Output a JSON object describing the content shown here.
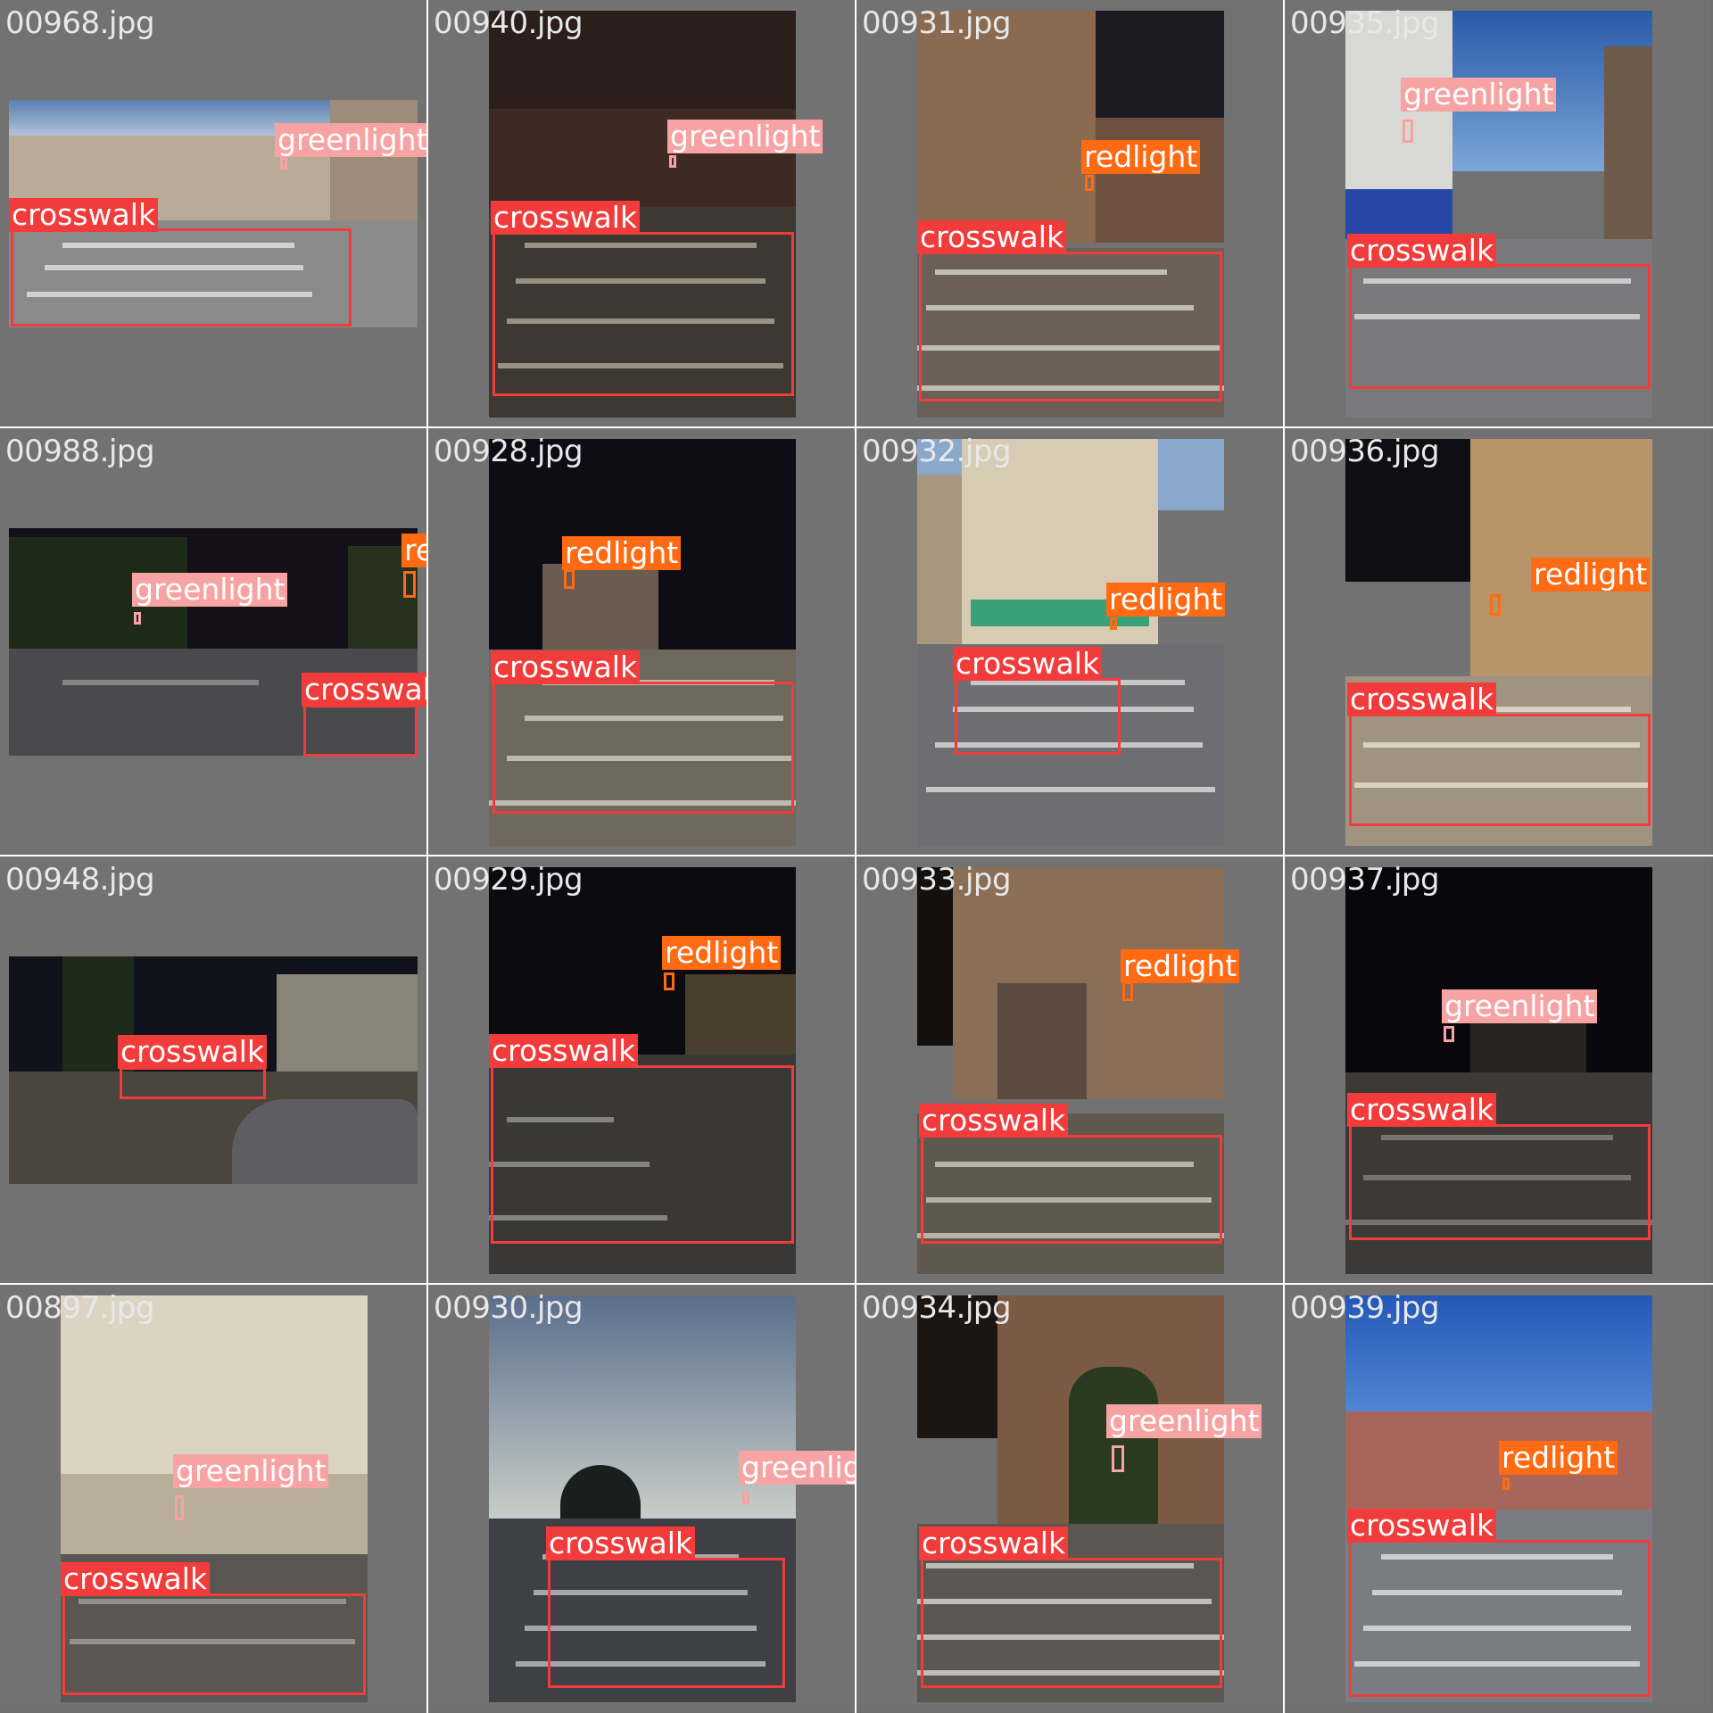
{
  "tiles": [
    {
      "filename": "00968.jpg",
      "labels": [
        "greenlight",
        "crosswalk"
      ]
    },
    {
      "filename": "00940.jpg",
      "labels": [
        "greenlight",
        "crosswalk"
      ]
    },
    {
      "filename": "00931.jpg",
      "labels": [
        "redlight",
        "crosswalk"
      ]
    },
    {
      "filename": "00935.jpg",
      "labels": [
        "greenlight",
        "crosswalk"
      ]
    },
    {
      "filename": "00988.jpg",
      "labels": [
        "redlight",
        "greenlight",
        "crosswalk"
      ]
    },
    {
      "filename": "00928.jpg",
      "labels": [
        "redlight",
        "crosswalk"
      ]
    },
    {
      "filename": "00932.jpg",
      "labels": [
        "redlight",
        "crosswalk"
      ]
    },
    {
      "filename": "00936.jpg",
      "labels": [
        "redlight",
        "crosswalk"
      ]
    },
    {
      "filename": "00948.jpg",
      "labels": [
        "crosswalk"
      ]
    },
    {
      "filename": "00929.jpg",
      "labels": [
        "redlight",
        "crosswalk"
      ]
    },
    {
      "filename": "00933.jpg",
      "labels": [
        "redlight",
        "crosswalk"
      ]
    },
    {
      "filename": "00937.jpg",
      "labels": [
        "greenlight",
        "crosswalk"
      ]
    },
    {
      "filename": "00897.jpg",
      "labels": [
        "greenlight",
        "crosswalk"
      ]
    },
    {
      "filename": "00930.jpg",
      "labels": [
        "greenlight",
        "crosswalk"
      ]
    },
    {
      "filename": "00934.jpg",
      "labels": [
        "greenlight",
        "crosswalk"
      ]
    },
    {
      "filename": "00939.jpg",
      "labels": [
        "redlight",
        "crosswalk"
      ]
    }
  ],
  "colors": {
    "crosswalk": "#f23b3b",
    "redlight": "#ff6a13",
    "greenlight": "#f7a3a3",
    "background": "#727272"
  }
}
